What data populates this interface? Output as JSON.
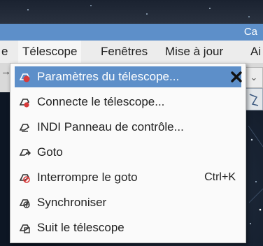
{
  "window": {
    "title": "Ca"
  },
  "menubar": {
    "items": [
      {
        "label": "e"
      },
      {
        "label": "Télescope"
      },
      {
        "label": "Fenêtres"
      },
      {
        "label": "Mise à jour"
      },
      {
        "label": "Ai"
      }
    ]
  },
  "toolbar": {
    "left_arrow": "→",
    "dropdown_arrow": "⌄"
  },
  "telescope_menu": {
    "items": [
      {
        "label": "Paramètres du télescope...",
        "icon": "telescope-settings-icon",
        "highlighted": true
      },
      {
        "label": "Connecte le télescope...",
        "icon": "telescope-connect-icon"
      },
      {
        "label": "INDI Panneau de contrôle...",
        "icon": "telescope-indi-icon"
      },
      {
        "label": "Goto",
        "icon": "telescope-goto-icon"
      },
      {
        "label": "Interrompre le goto",
        "icon": "telescope-abort-icon",
        "shortcut": "Ctrl+K"
      },
      {
        "label": "Synchroniser",
        "icon": "telescope-sync-icon"
      },
      {
        "label": "Suit le télescope",
        "icon": "telescope-track-icon"
      }
    ]
  },
  "colors": {
    "highlight": "#5d8fc9",
    "menu_background": "#fafafa",
    "icon_red": "#d83a3a"
  }
}
